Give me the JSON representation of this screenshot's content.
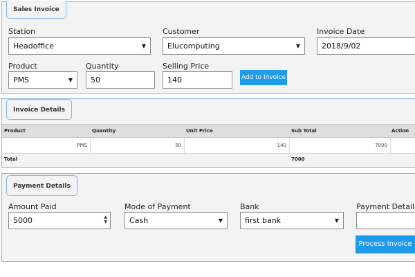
{
  "sales_invoice": {
    "legend": "Sales Invoice",
    "station": {
      "label": "Station",
      "value": "Headoffice"
    },
    "customer": {
      "label": "Customer",
      "value": "Elucomputing"
    },
    "invoice_date": {
      "label": "Invoice Date",
      "value": "2018/9/02"
    },
    "product": {
      "label": "Product",
      "value": "PMS"
    },
    "quantity": {
      "label": "Quantity",
      "value": "50"
    },
    "selling_price": {
      "label": "Selling Price",
      "value": "140"
    },
    "add_button": "Add to Invoice"
  },
  "invoice_details": {
    "legend": "Invoice Details",
    "columns": [
      "Product",
      "Quantity",
      "Unit Price",
      "Sub Total",
      "Action"
    ],
    "rows": [
      {
        "product": "PMS",
        "quantity": "50",
        "unit_price": "140",
        "sub_total": "7000"
      }
    ],
    "footer": {
      "label": "Total",
      "total": "7000"
    }
  },
  "payment_details": {
    "legend": "Payment Details",
    "amount_paid": {
      "label": "Amount Paid",
      "value": "5000"
    },
    "mode_of_payment": {
      "label": "Mode of Payment",
      "value": "Cash"
    },
    "bank": {
      "label": "Bank",
      "value": "first bank"
    },
    "payment_details_field": {
      "label": "Payment Details",
      "value": ""
    },
    "process_button": "Process Invoice"
  },
  "colors": {
    "accent": "#1e9be9",
    "border": "#7fb8e6",
    "panel": "#f3f3f3"
  },
  "icons": {
    "dropdown": "chevron-down-icon",
    "spinner": "spinner-icon"
  }
}
